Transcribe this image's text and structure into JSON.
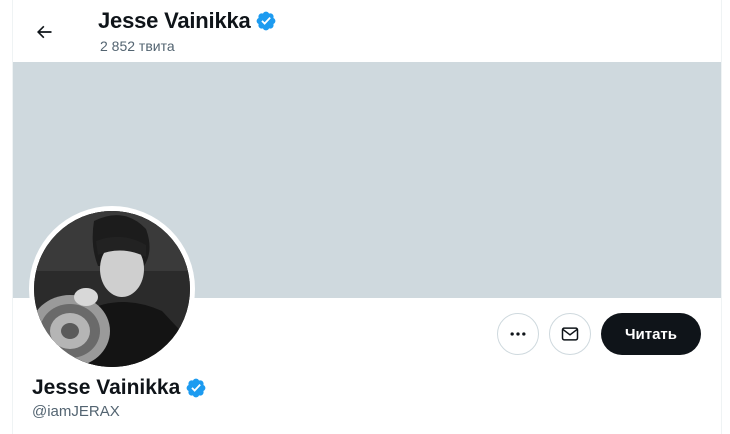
{
  "header": {
    "name": "Jesse Vainikka",
    "tweet_count": "2 852 твита",
    "back_icon": "arrow-left-icon",
    "verified_icon": "verified-badge-icon"
  },
  "banner": {
    "color": "#cfd9de"
  },
  "profile": {
    "name": "Jesse Vainikka",
    "handle": "@iamJERAX",
    "avatar_alt": "profile photo"
  },
  "actions": {
    "more_icon": "more-horizontal-icon",
    "message_icon": "envelope-icon",
    "follow_label": "Читать"
  },
  "colors": {
    "text_primary": "#0f1419",
    "text_secondary": "#536471",
    "verified_blue": "#1d9bf0",
    "follow_bg": "#0f1419"
  }
}
